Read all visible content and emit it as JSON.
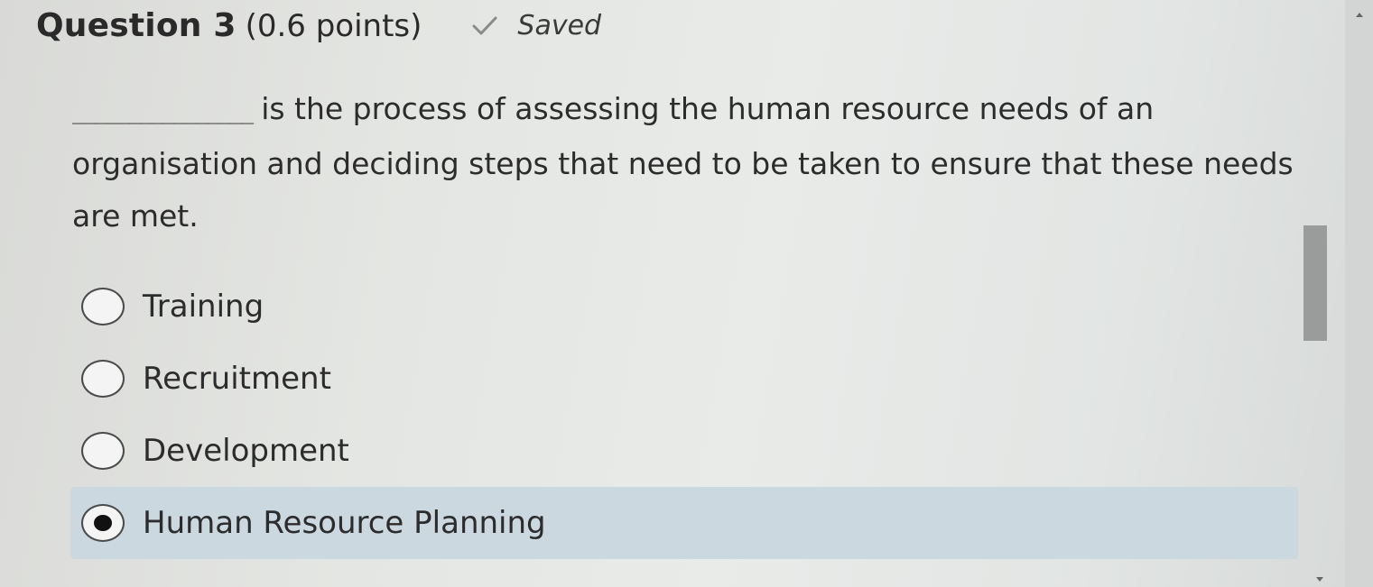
{
  "question": {
    "title": "Question 3",
    "points": "(0.6 points)",
    "status": "Saved",
    "blank": "________________",
    "text": "is the process of assessing the human resource needs of an organisation and deciding steps that need to be taken to ensure that these needs are met."
  },
  "options": [
    {
      "label": "Training",
      "selected": false
    },
    {
      "label": "Recruitment",
      "selected": false
    },
    {
      "label": "Development",
      "selected": false
    },
    {
      "label": "Human Resource Planning",
      "selected": true
    }
  ],
  "colors": {
    "selected_background": "#ccd8e0",
    "check": "#8a8a8a"
  },
  "icons": {
    "status": "check-icon",
    "scroll_up": "scroll-up-arrow-icon",
    "scroll_down": "scroll-down-arrow-icon"
  }
}
